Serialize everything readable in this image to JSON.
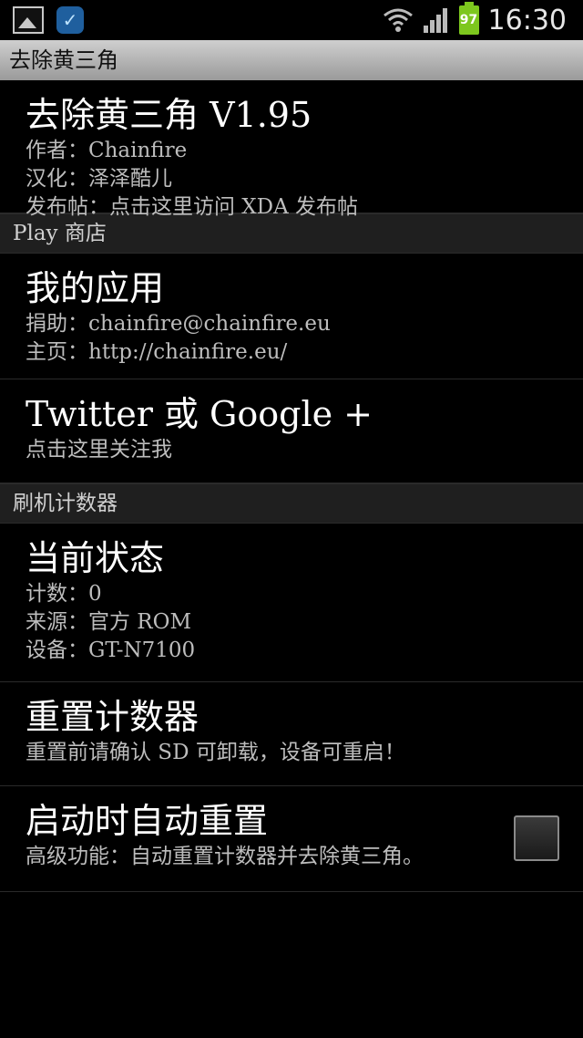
{
  "status_bar": {
    "time": "16:30",
    "battery_level": "97",
    "icons": [
      "gallery-notification-icon",
      "app-notification-icon",
      "wifi-icon",
      "signal-icon",
      "battery-icon"
    ]
  },
  "app": {
    "title": "去除黄三角"
  },
  "about": {
    "title": "去除黄三角 V1.95",
    "lines": [
      "作者：Chainfire",
      "汉化：泽泽酷儿",
      "发布帖：点击这里访问 XDA 发布帖"
    ]
  },
  "sections": {
    "play": "Play 商店",
    "flash_counter": "刷机计数器"
  },
  "my_apps": {
    "title": "我的应用",
    "lines": [
      "捐助：chainfire@chainfire.eu",
      "主页：http://chainfire.eu/"
    ]
  },
  "social": {
    "title": "Twitter 或 Google +",
    "lines": [
      "点击这里关注我"
    ]
  },
  "current_status": {
    "title": "当前状态",
    "lines": [
      "计数：0",
      "来源：官方 ROM",
      "设备：GT-N7100"
    ]
  },
  "reset": {
    "title": "重置计数器",
    "lines": [
      "重置前请确认 SD 可卸载，设备可重启！"
    ]
  },
  "auto_reset": {
    "title": "启动时自动重置",
    "lines": [
      "高级功能：自动重置计数器并去除黄三角。"
    ],
    "checked": false
  }
}
